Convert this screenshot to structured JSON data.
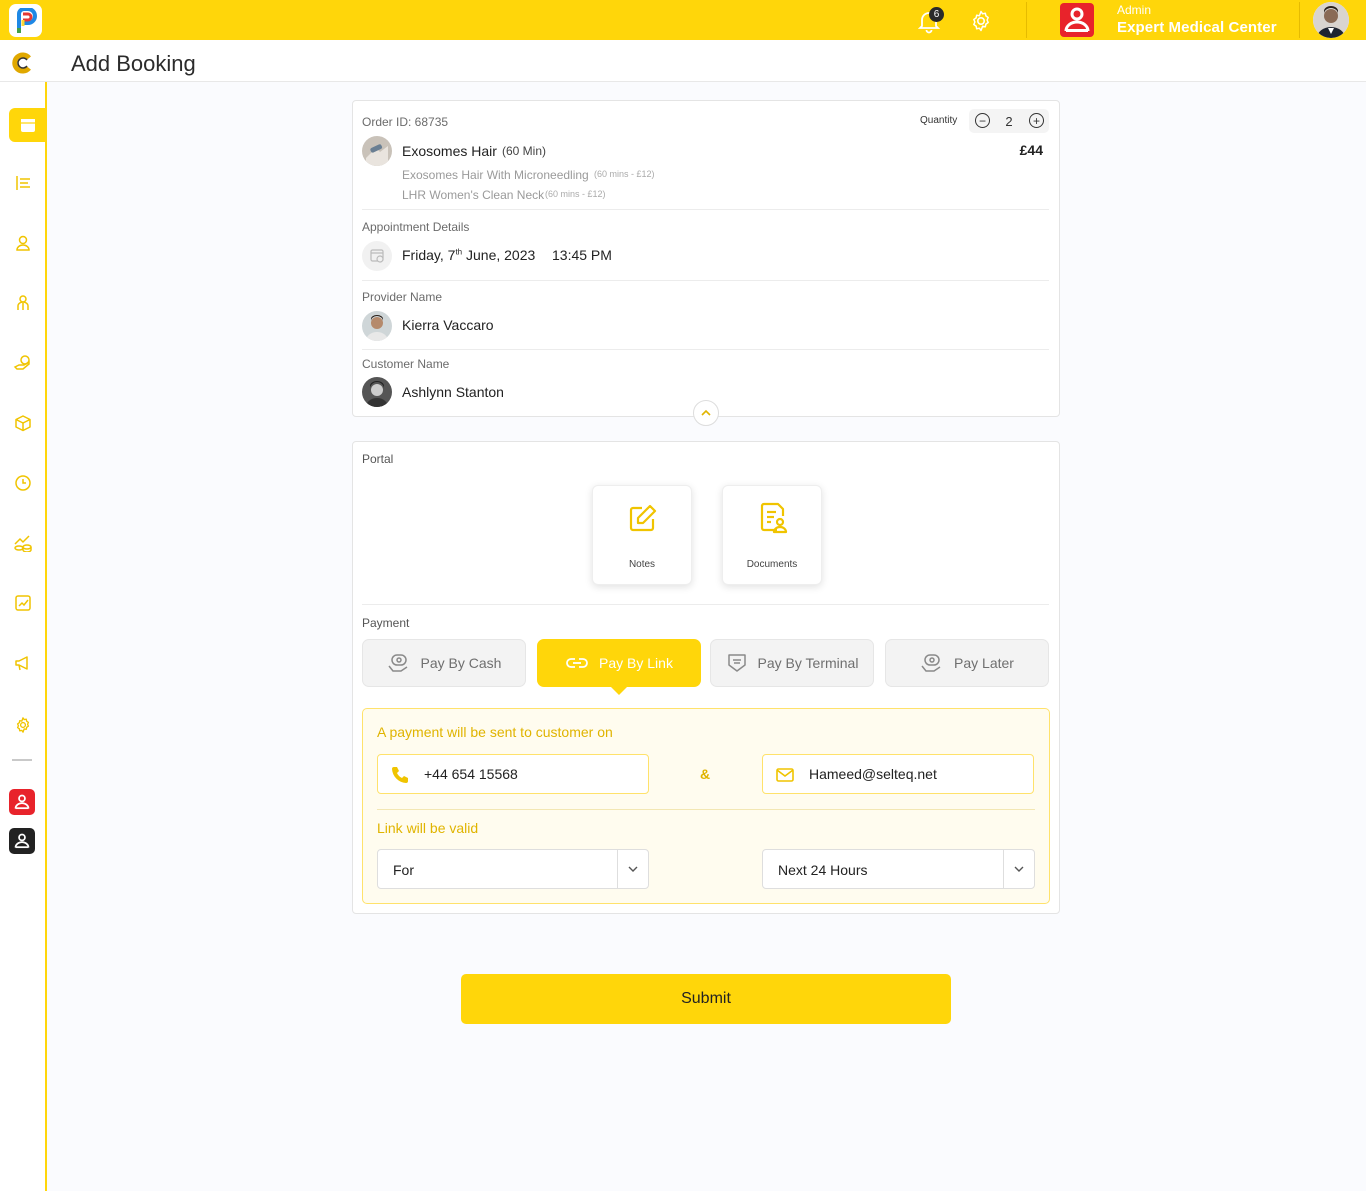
{
  "topbar": {
    "notification_count": "6",
    "role": "Admin",
    "center_name": "Expert Medical Center"
  },
  "header": {
    "title": "Add Booking"
  },
  "sidebar": {
    "icons": [
      "calendar-icon",
      "list-icon",
      "user-icon",
      "staff-icon",
      "service-hand-icon",
      "package-box-icon",
      "clock-icon",
      "finance-icon",
      "analytics-icon",
      "megaphone-icon",
      "settings-icon"
    ]
  },
  "order": {
    "order_id": "Order ID: 68735",
    "quantity_label": "Quantity",
    "quantity": "2",
    "service_name": "Exosomes Hair",
    "service_duration": "(60 Min)",
    "price": "£44",
    "addons": [
      {
        "name": "Exosomes Hair With Microneedling",
        "meta": "(60 mins - £12)"
      },
      {
        "name": "LHR Women's Clean Neck",
        "meta": "(60 mins - £12)"
      }
    ],
    "appointment_label": "Appointment Details",
    "appointment_day": "Friday, 7",
    "appointment_sup": "th",
    "appointment_rest": " June, 2023",
    "appointment_time": "13:45 PM",
    "provider_label": "Provider Name",
    "provider_name": "Kierra Vaccaro",
    "customer_label": "Customer Name",
    "customer_name": "Ashlynn Stanton"
  },
  "portal": {
    "label": "Portal",
    "tiles": [
      {
        "label": "Notes"
      },
      {
        "label": "Documents"
      }
    ]
  },
  "payment": {
    "label": "Payment",
    "options": [
      {
        "label": "Pay By Cash"
      },
      {
        "label": "Pay By Link"
      },
      {
        "label": "Pay By Terminal"
      },
      {
        "label": "Pay Later"
      }
    ],
    "selected": "Pay By Link",
    "sent_to_label": "A payment will be sent to customer on",
    "phone": "+44 654 15568",
    "ampersand": "&",
    "email": "Hameed@selteq.net",
    "valid_label": "Link will be valid",
    "valid_for": "For",
    "valid_period": "Next 24 Hours"
  },
  "submit_label": "Submit",
  "colors": {
    "accent": "#ffd60a",
    "accent_text": "#e0b400",
    "red_badge": "#e8232b"
  }
}
